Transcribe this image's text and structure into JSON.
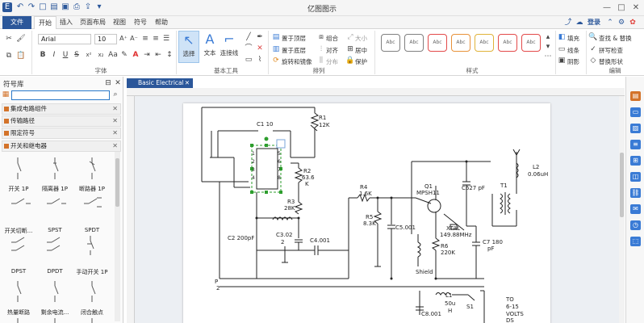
{
  "window": {
    "title": "亿图图示"
  },
  "menu": {
    "file": "文件",
    "start": "开始",
    "insert": "插入",
    "page_layout": "页面布局",
    "view": "视图",
    "symbol": "符号",
    "help": "帮助",
    "login": "登录"
  },
  "ribbon": {
    "font_name": "Arial",
    "font_size": "10",
    "tools": {
      "select": "选择",
      "text": "文本",
      "connector": "连接线"
    },
    "arrange": {
      "bring_front": "置于顶层",
      "send_back": "置于底层",
      "rotate_flip": "旋转和镜像",
      "group": "组合",
      "align": "对齐",
      "distribute": "分布",
      "size": "大小",
      "center": "居中",
      "protect": "保护"
    },
    "style_swatch_label": "Abc",
    "style_colors": [
      "#808080",
      "#808080",
      "#e34a4a",
      "#e8923a",
      "#e0b33a",
      "#e34a4a",
      "#e34a4a"
    ],
    "fill": {
      "fill": "填充",
      "line": "线条",
      "shadow": "阴影"
    },
    "edit": {
      "find_replace": "查找 & 替换",
      "spell_check": "拼写检查",
      "change_shape": "替换形状"
    },
    "groups": {
      "font": "字体",
      "basic_tools": "基本工具",
      "arrange": "排列",
      "styles": "样式",
      "edit": "编辑"
    }
  },
  "library": {
    "title": "符号库",
    "categories": [
      "集成电路组件",
      "传输路径",
      "限定符号",
      "开关和继电器"
    ],
    "symbols": [
      "开关 1P",
      "隔离器 1P",
      "断路器 1P",
      "开关切断...",
      "SPST",
      "SPDT",
      "DPST",
      "DPDT",
      "手动开关 1P",
      "热量断路",
      "剩余电流...",
      "闭合触点"
    ]
  },
  "document": {
    "tab": "Basic Electrical",
    "labels": {
      "c1": "C1 10",
      "r1": "R1",
      "r1v": "12K",
      "r2": "R2",
      "r2v": "63.6",
      "r2u": "K",
      "r3": "R3",
      "r3v": "28K",
      "c2": "C2 200pF",
      "c302": "C3.02",
      "c302v": "2",
      "c4": "C4.001",
      "r4": "R4",
      "r4v": "1.6K",
      "r5": "R5",
      "r5v": "8.3K",
      "c5": "C5.001",
      "q1": "Q1",
      "q1v": "MPSH11",
      "c627": "C627 pF",
      "xtal": "XTAL",
      "xtalv": "149.88MHz",
      "r6": "R6",
      "r6v": "220K",
      "c7": "C7 180",
      "c7u": "pF",
      "t1": "T1",
      "l2": "L2",
      "l2v": "0.06uH",
      "shield": "Shield",
      "p2": "P",
      "p2n": "2",
      "l1": "L1",
      "l1v": "50u",
      "l1u": "H",
      "s1": "S1",
      "c8": "C8.001",
      "to1": "TO",
      "to2": "6-15",
      "to3": "VOLTS",
      "to4": "DS",
      "ic": [
        "1",
        "2",
        "3",
        "4",
        "5",
        "6",
        "7",
        "8"
      ]
    }
  }
}
